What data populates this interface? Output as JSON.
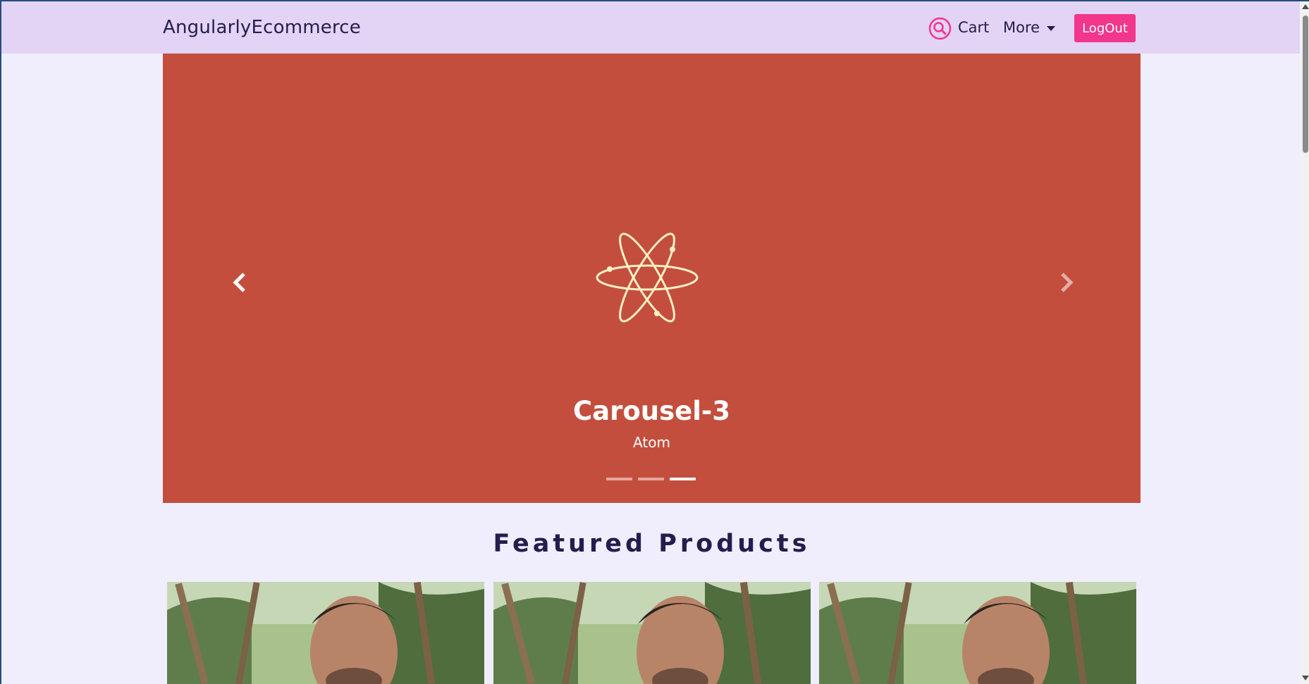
{
  "navbar": {
    "brand": "AngularlyEcommerce",
    "search_icon": "search-icon",
    "cart_label": "Cart",
    "more_label": "More",
    "logout_label": "LogOut",
    "colors": {
      "background": "#e3d3f5",
      "text": "#241d4e",
      "accent": "#f1368b"
    }
  },
  "carousel": {
    "title": "Carousel-3",
    "subtitle": "Atom",
    "icon": "atom-icon",
    "background": "#c44e3d",
    "active_index": 3,
    "slide_count": 3
  },
  "featured": {
    "title": "Featured Products",
    "products": [
      {
        "image": "man-portrait-photo"
      },
      {
        "image": "man-portrait-photo"
      },
      {
        "image": "man-portrait-photo"
      }
    ]
  }
}
